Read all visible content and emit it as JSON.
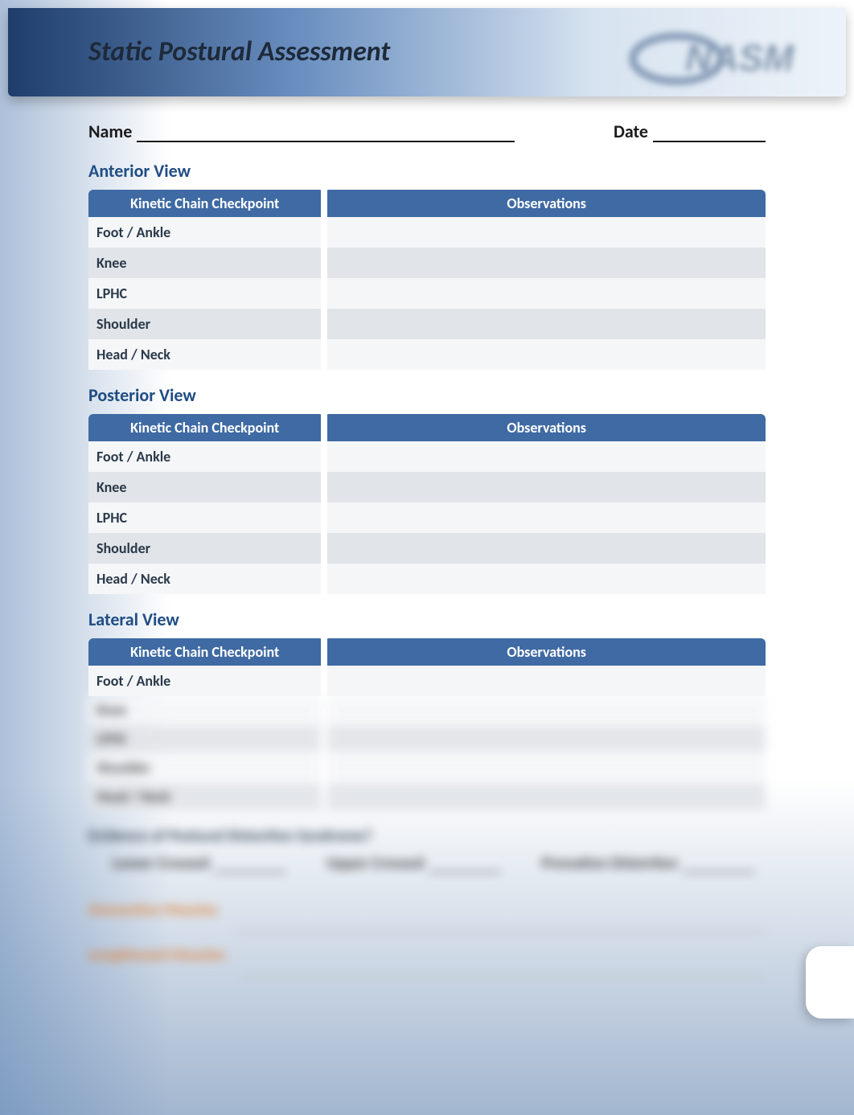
{
  "header": {
    "title": "Static Postural Assessment",
    "logo_name": "NASM"
  },
  "fields": {
    "name_label": "Name",
    "date_label": "Date"
  },
  "sections": [
    {
      "title": "Anterior View",
      "columns": [
        "Kinetic Chain Checkpoint",
        "Observations"
      ],
      "rows": [
        "Foot / Ankle",
        "Knee",
        "LPHC",
        "Shoulder",
        "Head / Neck"
      ]
    },
    {
      "title": "Posterior View",
      "columns": [
        "Kinetic Chain Checkpoint",
        "Observations"
      ],
      "rows": [
        "Foot / Ankle",
        "Knee",
        "LPHC",
        "Shoulder",
        "Head / Neck"
      ]
    },
    {
      "title": "Lateral View",
      "columns": [
        "Kinetic Chain Checkpoint",
        "Observations"
      ],
      "rows": [
        "Foot / Ankle"
      ],
      "blurred_rows": [
        "Knee",
        "LPHC",
        "Shoulder",
        "Head / Neck"
      ]
    }
  ],
  "blurred_bottom": {
    "heading": "Evidence of Postural Distortion Syndrome?",
    "items": [
      "Lower Crossed",
      "Upper Crossed",
      "Pronation Distortion"
    ],
    "orange1": "Overactive Muscles",
    "orange2": "Lengthened Muscles"
  }
}
